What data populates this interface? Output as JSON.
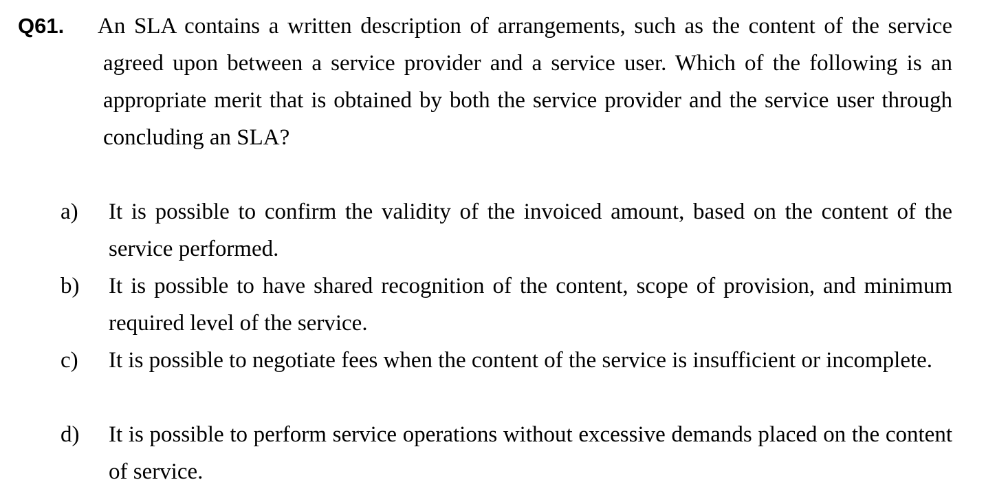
{
  "question": {
    "number": "Q61.",
    "stem": "An SLA contains a written description of arrangements, such as the content of the service agreed upon between a service provider and a service user. Which of the following is an appropriate merit that is obtained by both the service provider and the service user through concluding an SLA?"
  },
  "options": [
    {
      "label": "a)",
      "text": "It is possible to confirm the validity of the invoiced amount, based on the content of the service performed."
    },
    {
      "label": "b)",
      "text": "It is possible to have shared recognition of the content, scope of provision, and minimum required level of the service."
    },
    {
      "label": "c)",
      "text": "It is possible to negotiate fees when the content of the service is insufficient or incomplete."
    },
    {
      "label": "d)",
      "text": "It is possible to perform service operations without excessive demands placed on the content of service."
    }
  ]
}
